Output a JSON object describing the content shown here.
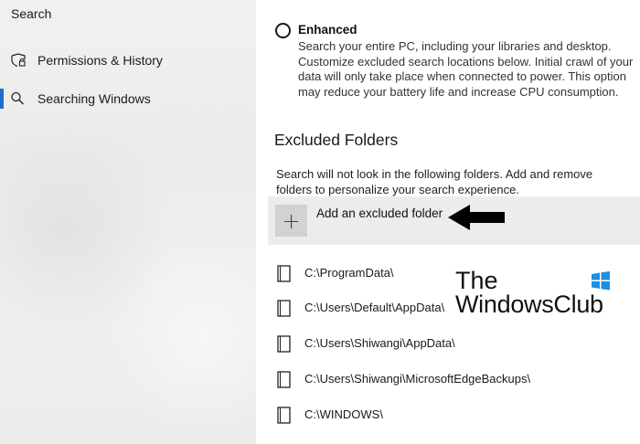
{
  "sidebar": {
    "title": "Search",
    "items": [
      {
        "label": "Permissions & History",
        "icon": "shield-lock-icon",
        "selected": false
      },
      {
        "label": "Searching Windows",
        "icon": "search-icon",
        "selected": true
      }
    ]
  },
  "main": {
    "enhanced_option": {
      "title": "Enhanced",
      "description": "Search your entire PC, including your libraries and desktop. Customize excluded search locations below. Initial crawl of your data will only take place when connected to power. This option may reduce your battery life and increase CPU consumption.",
      "selected": false
    },
    "excluded_section": {
      "heading": "Excluded Folders",
      "description": "Search will not look in the following folders. Add and remove folders to personalize your search experience.",
      "add_label": "Add an excluded folder",
      "folders": [
        "C:\\ProgramData\\",
        "C:\\Users\\Default\\AppData\\",
        "C:\\Users\\Shiwangi\\AppData\\",
        "C:\\Users\\Shiwangi\\MicrosoftEdgeBackups\\",
        "C:\\WINDOWS\\"
      ]
    }
  },
  "watermark": {
    "line1": "The",
    "line2": "WindowsClub"
  },
  "colors": {
    "accent": "#1a6fd1",
    "sidebar_bg": "#ededec",
    "add_row_bg": "#ececec",
    "logo_blue": "#1d8fe0"
  }
}
